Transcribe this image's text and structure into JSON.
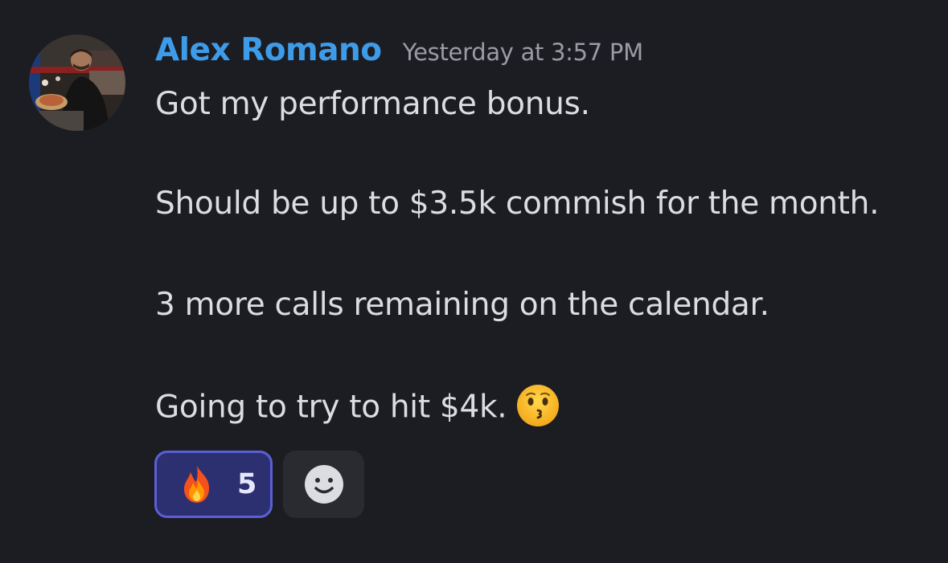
{
  "message": {
    "author": "Alex Romano",
    "timestamp": "Yesterday at 3:57 PM",
    "lines": [
      "Got my performance bonus.",
      "Should be up to $3.5k commish for the month.",
      "3 more calls remaining on the calendar.",
      "Going to try to hit $4k."
    ],
    "trailing_emoji": "kissing-face-emoji"
  },
  "reactions": [
    {
      "emoji": "fire-emoji",
      "count": "5",
      "selected": true
    }
  ],
  "add_reaction": {
    "icon": "smiley-icon"
  },
  "colors": {
    "background": "#1c1d22",
    "username": "#3e9be8",
    "timestamp": "#9a9ca3",
    "text": "#dcdde0",
    "reaction_border": "#5c5fd6",
    "reaction_bg": "#2d3070"
  }
}
